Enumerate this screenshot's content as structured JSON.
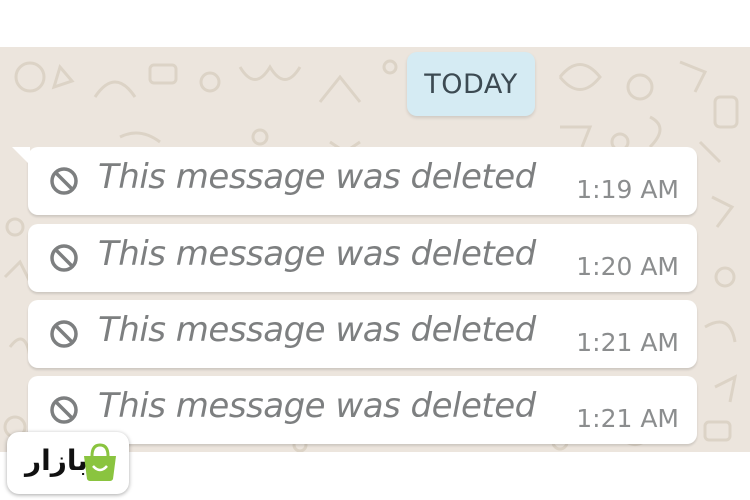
{
  "chat": {
    "date_chip": "TODAY",
    "messages": [
      {
        "text": "This message was deleted",
        "time": "1:19 AM",
        "icon": "ban-icon"
      },
      {
        "text": "This message was deleted",
        "time": "1:20 AM",
        "icon": "ban-icon"
      },
      {
        "text": "This message was deleted",
        "time": "1:21 AM",
        "icon": "ban-icon"
      },
      {
        "text": "This message was deleted",
        "time": "1:21 AM",
        "icon": "ban-icon"
      }
    ]
  },
  "watermark": {
    "brand_text": "بازار",
    "icon": "shopping-bag-icon",
    "accent_color": "#8ac43f"
  },
  "colors": {
    "chat_background": "#ece5dd",
    "date_chip_background": "#d5ebf3",
    "bubble_background": "#ffffff"
  }
}
